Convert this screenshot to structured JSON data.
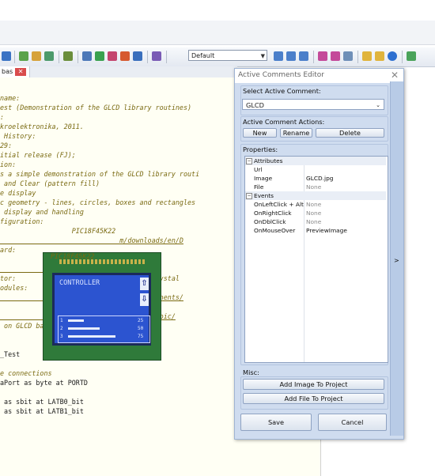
{
  "toolbar": {
    "scheme_value": "Default"
  },
  "tab": {
    "label": "bas",
    "close_glyph": "✕"
  },
  "editor": {
    "lines": [
      {
        "text": "name:",
        "style": "comment"
      },
      {
        "text": "est (Demonstration of the GLCD library routines)",
        "style": "comment"
      },
      {
        "text": ":",
        "style": "comment"
      },
      {
        "text": "kroelektronika, 2011.",
        "style": "comment"
      },
      {
        "text": " History:",
        "style": "comment"
      },
      {
        "text": "29:",
        "style": "comment"
      },
      {
        "text": "itial release (FJ);",
        "style": "comment"
      },
      {
        "text": "ion:",
        "style": "comment"
      },
      {
        "text": "s a simple demonstration of the GLCD library routi",
        "style": "comment"
      },
      {
        "text": " and Clear (pattern fill)",
        "style": "comment"
      },
      {
        "text": "e display",
        "style": "comment"
      },
      {
        "text": "c geometry - lines, circles, boxes and rectangles",
        "style": "comment"
      },
      {
        "text": " display and handling",
        "style": "comment"
      },
      {
        "text": "figuration:",
        "style": "comment"
      },
      {
        "text": "                  PIC18F45K22",
        "style": "comment"
      },
      {
        "text": "                              m/downloads/en/D",
        "style": "link"
      },
      {
        "text": "ard:",
        "style": "comment"
      },
      {
        "text": "",
        "style": "comment"
      },
      {
        "text": "                              asypic/",
        "style": "link"
      },
      {
        "text": "tor:                          000 MHz Crystal",
        "style": "comment"
      },
      {
        "text": "odules:                       controller",
        "style": "comment"
      },
      {
        "text": "                              tore/components/",
        "style": "link"
      },
      {
        "text": "",
        "style": "comment"
      },
      {
        "text": "                              ikrobasic/pic/",
        "style": "link"
      },
      {
        "text": " on GLCD backlight switch SW4.6.",
        "style": "comment"
      },
      {
        "text": "",
        "style": "comment"
      },
      {
        "text": "",
        "style": "comment"
      },
      {
        "text": "_Test",
        "style": "normal"
      },
      {
        "text": "",
        "style": "comment"
      },
      {
        "text": "e connections",
        "style": "comment"
      },
      {
        "text": "aPort as byte at PORTD",
        "style": "mixed"
      },
      {
        "text": "",
        "style": "comment"
      },
      {
        "text": " as sbit at LATB0_bit",
        "style": "mixed"
      },
      {
        "text": " as sbit at LATB1_bit",
        "style": "mixed"
      }
    ]
  },
  "glcd": {
    "chip_label": "PIC18F45K22",
    "screen_text": "CONTROLLER",
    "up_glyph": "⇧",
    "down_glyph": "⇩",
    "rows": [
      {
        "num": "1",
        "value": "25",
        "fill": 0.25
      },
      {
        "num": "2",
        "value": "50",
        "fill": 0.5
      },
      {
        "num": "3",
        "value": "75",
        "fill": 0.75
      }
    ]
  },
  "dialog": {
    "title": "Active Comments Editor",
    "close_glyph": "✕",
    "select_label": "Select Active Comment:",
    "selected_comment": "GLCD",
    "actions_label": "Active Comment Actions:",
    "new_label": "New",
    "rename_label": "Rename",
    "delete_label": "Delete",
    "properties_label": "Properties:",
    "attributes_label": "Attributes",
    "events_label": "Events",
    "properties": [
      {
        "name": "Url",
        "value": ""
      },
      {
        "name": "Image",
        "value": "GLCD.jpg"
      },
      {
        "name": "File",
        "value": "None"
      }
    ],
    "events": [
      {
        "name": "OnLeftClick + Alt",
        "value": "None"
      },
      {
        "name": "OnRightClick",
        "value": "None"
      },
      {
        "name": "OnDblClick",
        "value": "None"
      },
      {
        "name": "OnMouseOver",
        "value": "PreviewImage"
      }
    ],
    "misc_label": "Misc:",
    "add_image_label": "Add Image To Project",
    "add_file_label": "Add File To Project",
    "save_label": "Save",
    "cancel_label": "Cancel",
    "expand_glyph": ">"
  }
}
